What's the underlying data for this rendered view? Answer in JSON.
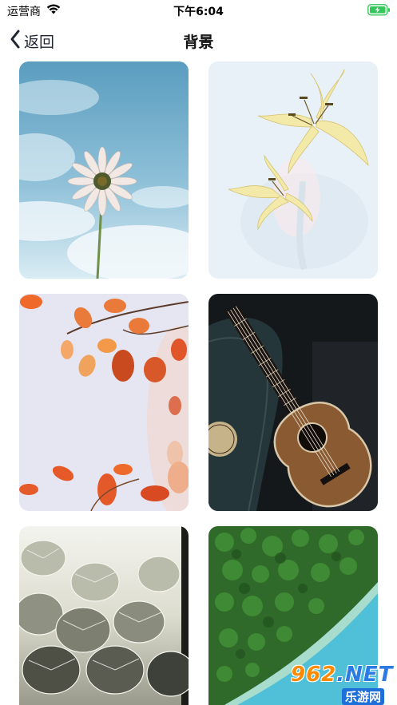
{
  "status_bar": {
    "carrier": "运营商",
    "time": "下午6:04"
  },
  "nav": {
    "back_label": "返回",
    "title": "背景"
  },
  "wallpapers": [
    {
      "subject": "daisy-sky"
    },
    {
      "subject": "yellow-lily"
    },
    {
      "subject": "orange-leaves"
    },
    {
      "subject": "ukulele"
    },
    {
      "subject": "monstera-leaves"
    },
    {
      "subject": "forest-coast"
    }
  ],
  "watermark": {
    "logo_main": "962",
    "logo_net": ".NET",
    "logo_sub": "乐游网"
  },
  "colors": {
    "battery_green": "#34c759",
    "nav_text": "#1f2433"
  }
}
